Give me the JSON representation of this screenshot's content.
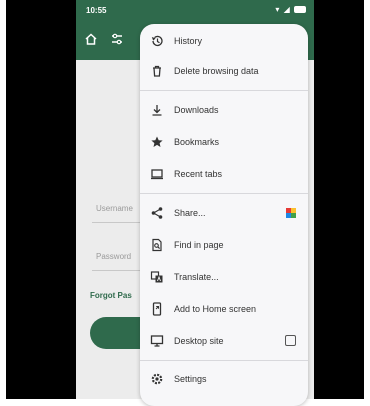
{
  "status_bar": {
    "time": "10:55"
  },
  "page": {
    "username_placeholder": "Username",
    "password_placeholder": "Password",
    "forgot_link": "Forgot Pas"
  },
  "menu": {
    "items": [
      {
        "label": "History",
        "icon": "history-icon"
      },
      {
        "label": "Delete browsing data",
        "icon": "trash-icon"
      },
      {
        "label": "Downloads",
        "icon": "download-icon"
      },
      {
        "label": "Bookmarks",
        "icon": "star-icon"
      },
      {
        "label": "Recent tabs",
        "icon": "recent-tabs-icon"
      },
      {
        "label": "Share...",
        "icon": "share-icon"
      },
      {
        "label": "Find in page",
        "icon": "find-in-page-icon"
      },
      {
        "label": "Translate...",
        "icon": "translate-icon"
      },
      {
        "label": "Add to Home screen",
        "icon": "add-to-home-icon"
      },
      {
        "label": "Desktop site",
        "icon": "desktop-icon"
      },
      {
        "label": "Settings",
        "icon": "gear-icon"
      }
    ]
  },
  "colors": {
    "brand_green": "#2f6a4c",
    "menu_background": "#f7f7f9"
  }
}
